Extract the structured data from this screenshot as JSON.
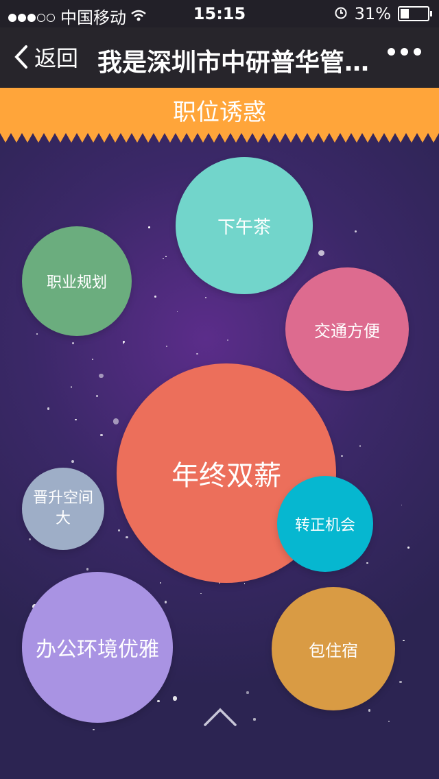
{
  "status": {
    "carrier": "中国移动",
    "time": "15:15",
    "battery": "31%"
  },
  "nav": {
    "back_label": "返回",
    "title": "我是深圳市中研普华管理咨询有限公司"
  },
  "banner": {
    "title": "职位诱惑"
  },
  "bubbles": [
    {
      "label": "下午茶",
      "color": "#72d5cb"
    },
    {
      "label": "职业规划",
      "color": "#6bad7e"
    },
    {
      "label": "交通方便",
      "color": "#dd6b8f"
    },
    {
      "label": "年终双薪",
      "color": "#ec6f5b"
    },
    {
      "label": "晋升空间大",
      "color": "#9eaec7"
    },
    {
      "label": "转正机会",
      "color": "#06b7d0"
    },
    {
      "label": "办公环境优雅",
      "color": "#a993e3"
    },
    {
      "label": "包住宿",
      "color": "#d99b44"
    }
  ]
}
